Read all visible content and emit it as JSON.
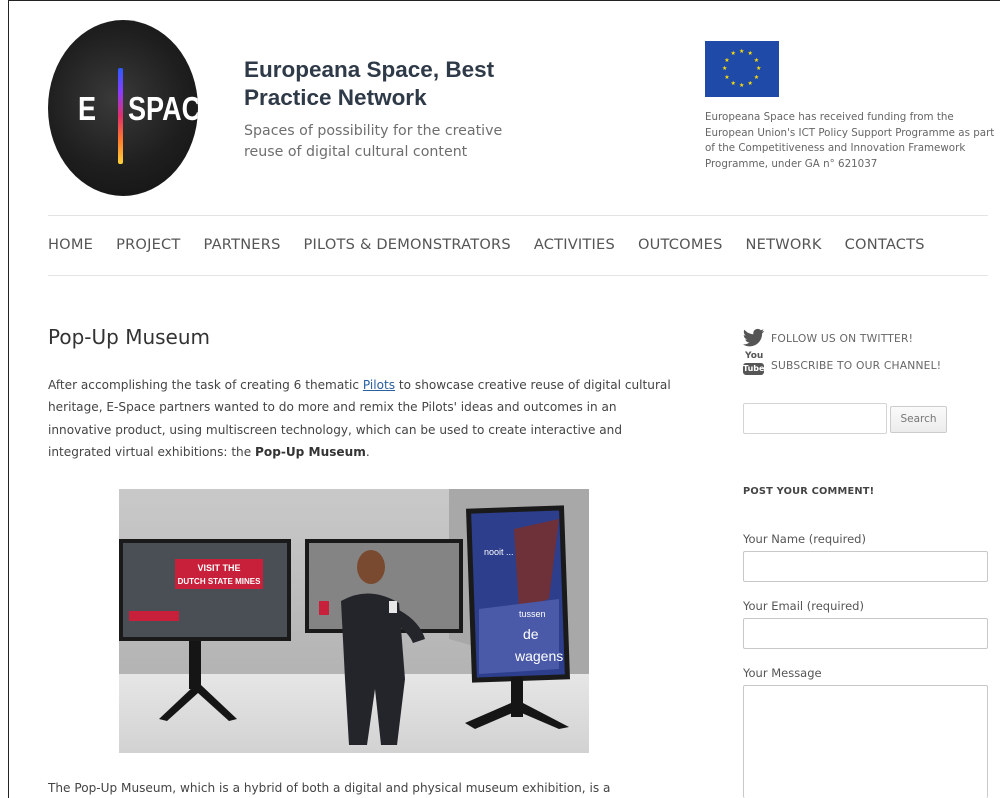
{
  "logo": {
    "letter": "E",
    "word": "SPACE"
  },
  "header": {
    "title": "Europeana Space, Best Practice Network",
    "tagline": "Spaces of possibility for the creative reuse of digital cultural content",
    "eu_notice": "Europeana Space has received funding from the European Union's ICT Policy Support Programme as part of the Competitiveness and Innovation Framework Programme, under GA n° 621037"
  },
  "nav": {
    "items": [
      "HOME",
      "PROJECT",
      "PARTNERS",
      "PILOTS & DEMONSTRATORS",
      "ACTIVITIES",
      "OUTCOMES",
      "NETWORK",
      "CONTACTS"
    ]
  },
  "main": {
    "title": "Pop-Up Museum",
    "intro_before_link": "After accomplishing the task of creating 6 thematic ",
    "intro_link": "Pilots",
    "intro_after_link": " to showcase creative reuse of digital cultural heritage, E-Space partners wanted to do more and remix the Pilots' ideas and outcomes in an innovative product, using multiscreen technology, which can be used to create interactive and integrated virtual exhibitions: the ",
    "intro_bold": "Pop-Up Museum",
    "intro_end": ".",
    "image": {
      "screen_left_line1": "VISIT THE",
      "screen_left_line2": "DUTCH STATE MINES",
      "screen_right_word1": "nooit ...",
      "screen_right_word2": "tussen",
      "screen_right_word3": "de",
      "screen_right_word4": "wagens"
    },
    "bottom_text": "The Pop-Up Museum, which is a hybrid of both a digital and physical museum exhibition, is a"
  },
  "sidebar": {
    "twitter_label": "FOLLOW US ON TWITTER!",
    "youtube_label": "SUBSCRIBE TO OUR CHANNEL!",
    "youtube_you": "You",
    "youtube_tube": "Tube",
    "search_button": "Search",
    "comment_heading": "POST YOUR COMMENT!",
    "name_label": "Your Name (required)",
    "email_label": "Your Email (required)",
    "message_label": "Your Message"
  },
  "colors": {
    "eu_blue": "#1f4aa8",
    "eu_star": "#ffdd00",
    "link": "#2b5f9e",
    "title": "#2f3a48"
  }
}
